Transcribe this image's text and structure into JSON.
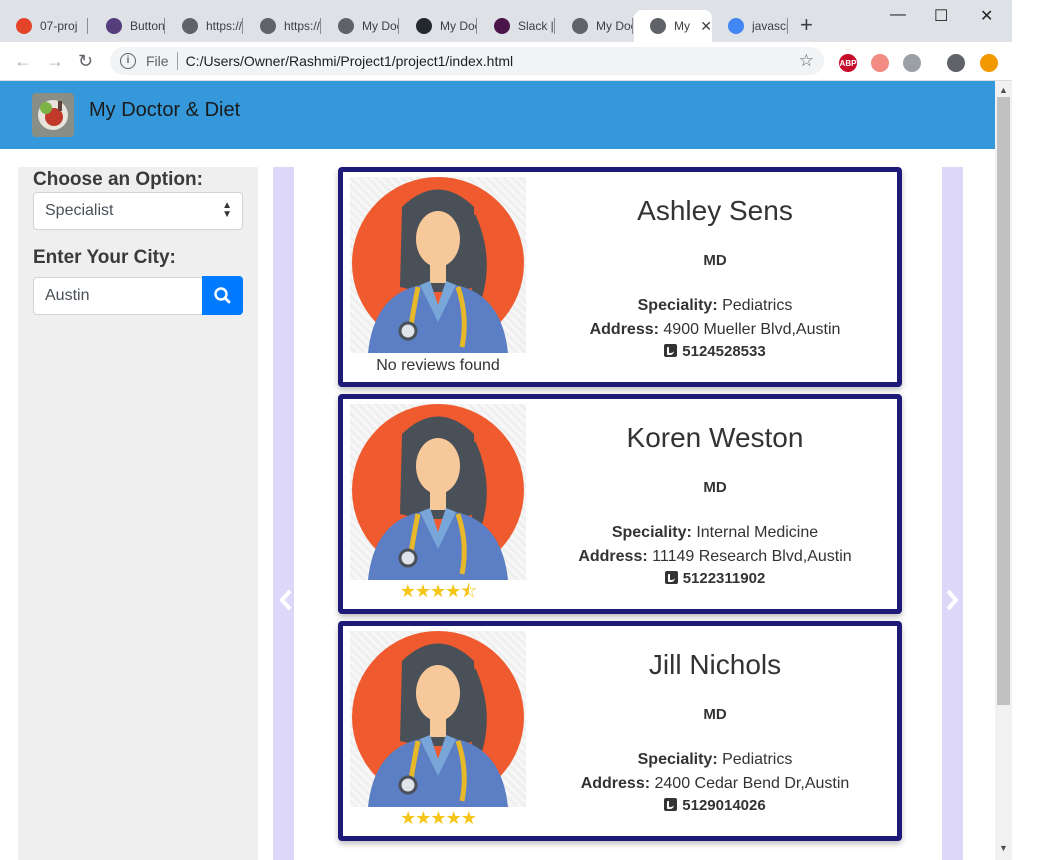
{
  "browser": {
    "tabs": [
      {
        "title": "07-proj",
        "favicon": "gitlab-icon",
        "color": "#e24329"
      },
      {
        "title": "Buttons",
        "favicon": "bootstrap-icon",
        "color": "#563d7c"
      },
      {
        "title": "https://",
        "favicon": "globe-icon",
        "color": "#5f6368"
      },
      {
        "title": "https://",
        "favicon": "globe-icon",
        "color": "#5f6368"
      },
      {
        "title": "My Doc",
        "favicon": "globe-icon",
        "color": "#5f6368"
      },
      {
        "title": "My Doc",
        "favicon": "github-icon",
        "color": "#24292e"
      },
      {
        "title": "Slack |",
        "favicon": "slack-icon",
        "color": "#4a154b"
      },
      {
        "title": "My Doc",
        "favicon": "globe-icon",
        "color": "#5f6368"
      },
      {
        "title": "My",
        "favicon": "globe-icon",
        "color": "#5f6368",
        "active": true
      },
      {
        "title": "javascr",
        "favicon": "google-icon",
        "color": "#4285f4"
      }
    ],
    "new_tab": "+",
    "window_controls": {
      "minimize": "—",
      "maximize": "☐",
      "close": "✕"
    },
    "nav": {
      "back": "←",
      "forward": "→",
      "reload": "↻"
    },
    "address": {
      "scheme_label": "File",
      "url": "C:/Users/Owner/Rashmi/Project1/project1/index.html",
      "star": "☆"
    },
    "extensions": [
      {
        "name": "abp-icon",
        "label": "ABP",
        "color": "#c70d2c"
      },
      {
        "name": "extension-arrow-icon",
        "label": "",
        "color": "#f28b82"
      },
      {
        "name": "extension-circle-icon",
        "label": "",
        "color": "#9aa0a6"
      },
      {
        "name": "profile-icon",
        "label": "",
        "color": "#5f6368"
      },
      {
        "name": "update-icon",
        "label": "",
        "color": "#f29900"
      }
    ]
  },
  "header": {
    "brand": "My Doctor & Diet",
    "color": "#3498db"
  },
  "sidebar": {
    "option_label": "Choose an Option:",
    "option_value": "Specialist",
    "city_label": "Enter Your City:",
    "city_value": "Austin",
    "search_icon": "search-icon"
  },
  "doctors": [
    {
      "name": "Ashley Sens",
      "degree": "MD",
      "speciality_label": "Speciality:",
      "speciality": "Pediatrics",
      "address_label": "Address:",
      "address": "4900 Mueller Blvd,Austin",
      "phone": "5124528533",
      "reviews_text": "No reviews found",
      "rating": null
    },
    {
      "name": "Koren Weston",
      "degree": "MD",
      "speciality_label": "Speciality:",
      "speciality": "Internal Medicine",
      "address_label": "Address:",
      "address": "11149 Research Blvd,Austin",
      "phone": "5122311902",
      "reviews_text": "",
      "rating": 4.5
    },
    {
      "name": "Jill Nichols",
      "degree": "MD",
      "speciality_label": "Speciality:",
      "speciality": "Pediatrics",
      "address_label": "Address:",
      "address": "2400 Cedar Bend Dr,Austin",
      "phone": "5129014026",
      "reviews_text": "",
      "rating": 5
    }
  ]
}
